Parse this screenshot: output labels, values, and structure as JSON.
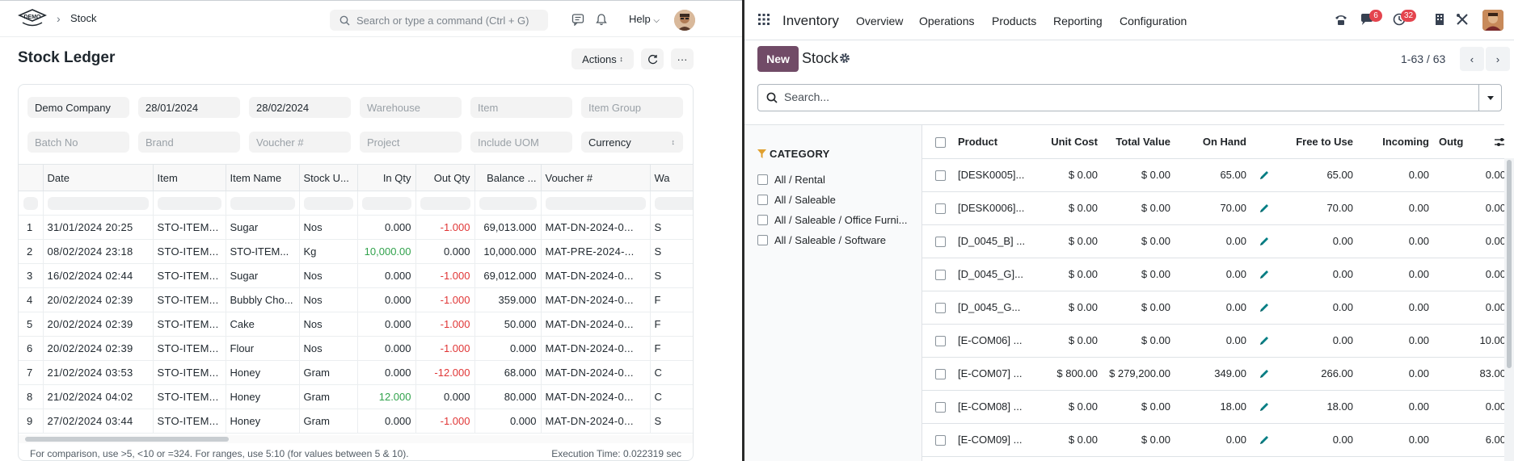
{
  "left": {
    "logo_text": "DEMO",
    "breadcrumb": "Stock",
    "search_placeholder": "Search or type a command (Ctrl + G)",
    "help_label": "Help",
    "page_title": "Stock Ledger",
    "actions_label": "Actions",
    "filters": {
      "company": "Demo Company",
      "from_date": "28/01/2024",
      "to_date": "28/02/2024",
      "warehouse": "Warehouse",
      "item": "Item",
      "item_group": "Item Group",
      "batch_no": "Batch No",
      "brand": "Brand",
      "voucher_no": "Voucher #",
      "project": "Project",
      "include_uom": "Include UOM",
      "currency": "Currency"
    },
    "columns": [
      "Date",
      "Item",
      "Item Name",
      "Stock U...",
      "In Qty",
      "Out Qty",
      "Balance ...",
      "Voucher #",
      "Wa"
    ],
    "rows": [
      {
        "idx": "1",
        "date": "31/01/2024 20:25",
        "item": "STO-ITEM...",
        "name": "Sugar",
        "uom": "Nos",
        "in": "0.000",
        "out": "-1.000",
        "bal": "69,013.000",
        "voucher": "MAT-DN-2024-0...",
        "wh": "S"
      },
      {
        "idx": "2",
        "date": "08/02/2024 23:18",
        "item": "STO-ITEM...",
        "name": "STO-ITEM...",
        "uom": "Kg",
        "in": "10,000.00",
        "out": "0.000",
        "bal": "10,000.000",
        "voucher": "MAT-PRE-2024-...",
        "wh": "S"
      },
      {
        "idx": "3",
        "date": "16/02/2024 02:44",
        "item": "STO-ITEM...",
        "name": "Sugar",
        "uom": "Nos",
        "in": "0.000",
        "out": "-1.000",
        "bal": "69,012.000",
        "voucher": "MAT-DN-2024-0...",
        "wh": "S"
      },
      {
        "idx": "4",
        "date": "20/02/2024 02:39",
        "item": "STO-ITEM...",
        "name": "Bubbly Cho...",
        "uom": "Nos",
        "in": "0.000",
        "out": "-1.000",
        "bal": "359.000",
        "voucher": "MAT-DN-2024-0...",
        "wh": "F"
      },
      {
        "idx": "5",
        "date": "20/02/2024 02:39",
        "item": "STO-ITEM...",
        "name": "Cake",
        "uom": "Nos",
        "in": "0.000",
        "out": "-1.000",
        "bal": "50.000",
        "voucher": "MAT-DN-2024-0...",
        "wh": "F"
      },
      {
        "idx": "6",
        "date": "20/02/2024 02:39",
        "item": "STO-ITEM...",
        "name": "Flour",
        "uom": "Nos",
        "in": "0.000",
        "out": "-1.000",
        "bal": "0.000",
        "voucher": "MAT-DN-2024-0...",
        "wh": "F"
      },
      {
        "idx": "7",
        "date": "21/02/2024 03:53",
        "item": "STO-ITEM...",
        "name": "Honey",
        "uom": "Gram",
        "in": "0.000",
        "out": "-12.000",
        "bal": "68.000",
        "voucher": "MAT-DN-2024-0...",
        "wh": "C"
      },
      {
        "idx": "8",
        "date": "21/02/2024 04:02",
        "item": "STO-ITEM...",
        "name": "Honey",
        "uom": "Gram",
        "in": "12.000",
        "out": "0.000",
        "bal": "80.000",
        "voucher": "MAT-DN-2024-0...",
        "wh": "C"
      },
      {
        "idx": "9",
        "date": "27/02/2024 03:44",
        "item": "STO-ITEM...",
        "name": "Honey",
        "uom": "Gram",
        "in": "0.000",
        "out": "-1.000",
        "bal": "0.000",
        "voucher": "MAT-DN-2024-0...",
        "wh": "S"
      }
    ],
    "footer_hint": "For comparison, use >5, <10 or =324. For ranges, use 5:10 (for values between 5 & 10).",
    "execution_time": "Execution Time: 0.022319 sec"
  },
  "right": {
    "app_name": "Inventory",
    "menu": [
      "Overview",
      "Operations",
      "Products",
      "Reporting",
      "Configuration"
    ],
    "badges": {
      "messages": "6",
      "activities": "32"
    },
    "new_label": "New",
    "view_title": "Stock",
    "pager": "1-63 / 63",
    "search_placeholder": "Search...",
    "category_title": "CATEGORY",
    "categories": [
      "All / Rental",
      "All / Saleable",
      "All / Saleable / Office Furni...",
      "All / Saleable / Software"
    ],
    "columns": [
      "Product",
      "Unit Cost",
      "Total Value",
      "On Hand",
      "Free to Use",
      "Incoming",
      "Outg"
    ],
    "rows": [
      {
        "product": "[DESK0005]...",
        "cost": "$ 0.00",
        "value": "$ 0.00",
        "onhand": "65.00",
        "free": "65.00",
        "incoming": "0.00",
        "out": "0.00"
      },
      {
        "product": "[DESK0006]...",
        "cost": "$ 0.00",
        "value": "$ 0.00",
        "onhand": "70.00",
        "free": "70.00",
        "incoming": "0.00",
        "out": "0.00"
      },
      {
        "product": "[D_0045_B] ...",
        "cost": "$ 0.00",
        "value": "$ 0.00",
        "onhand": "0.00",
        "free": "0.00",
        "incoming": "0.00",
        "out": "0.00"
      },
      {
        "product": "[D_0045_G]...",
        "cost": "$ 0.00",
        "value": "$ 0.00",
        "onhand": "0.00",
        "free": "0.00",
        "incoming": "0.00",
        "out": "0.00"
      },
      {
        "product": "[D_0045_G...",
        "cost": "$ 0.00",
        "value": "$ 0.00",
        "onhand": "0.00",
        "free": "0.00",
        "incoming": "0.00",
        "out": "0.00"
      },
      {
        "product": "[E-COM06] ...",
        "cost": "$ 0.00",
        "value": "$ 0.00",
        "onhand": "0.00",
        "free": "0.00",
        "incoming": "0.00",
        "out": "10.00"
      },
      {
        "product": "[E-COM07] ...",
        "cost": "$ 800.00",
        "value": "$ 279,200.00",
        "onhand": "349.00",
        "free": "266.00",
        "incoming": "0.00",
        "out": "83.00"
      },
      {
        "product": "[E-COM08] ...",
        "cost": "$ 0.00",
        "value": "$ 0.00",
        "onhand": "18.00",
        "free": "18.00",
        "incoming": "0.00",
        "out": "0.00"
      },
      {
        "product": "[E-COM09] ...",
        "cost": "$ 0.00",
        "value": "$ 0.00",
        "onhand": "0.00",
        "free": "0.00",
        "incoming": "0.00",
        "out": "6.00"
      }
    ]
  }
}
